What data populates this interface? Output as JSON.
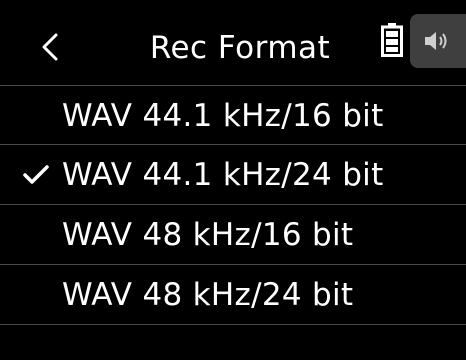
{
  "header": {
    "title": "Rec Format",
    "back_icon": "chevron-left-icon",
    "battery_icon": "battery-icon",
    "speaker_icon": "speaker-icon"
  },
  "options": [
    {
      "label": "WAV 44.1 kHz/16 bit",
      "selected": false
    },
    {
      "label": "WAV 44.1 kHz/24 bit",
      "selected": true
    },
    {
      "label": "WAV 48 kHz/16 bit",
      "selected": false
    },
    {
      "label": "WAV 48 kHz/24 bit",
      "selected": false
    }
  ],
  "colors": {
    "background": "#000000",
    "text": "#ffffff",
    "divider": "#4a4a4a",
    "tab": "#3f3f3f"
  }
}
